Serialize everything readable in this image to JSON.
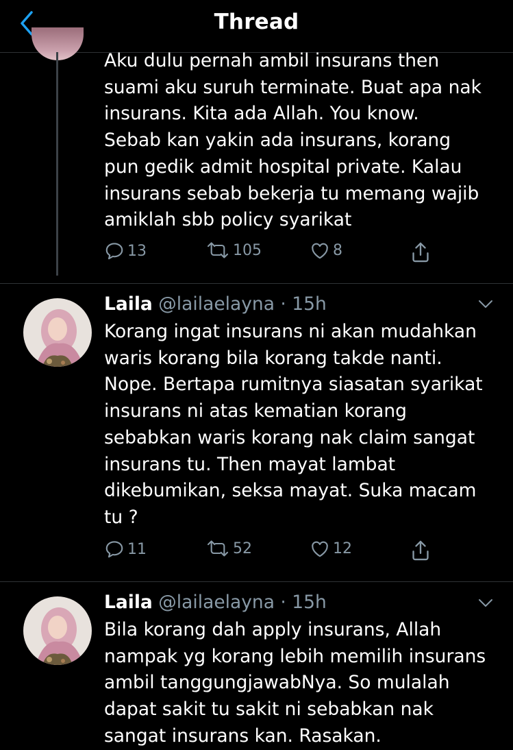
{
  "header": {
    "title": "Thread"
  },
  "tweets": [
    {
      "text": "Aku dulu pernah ambil insurans then\nsuami aku suruh terminate. Buat apa nak\ninsurans. Kita ada Allah. You know.\nSebab kan yakin ada insurans, korang\npun gedik admit hospital private. Kalau\ninsurans sebab bekerja tu memang wajib\namiklah sbb policy syarikat",
      "replies": "13",
      "retweets": "105",
      "likes": "8"
    },
    {
      "name": "Laila",
      "handle": "@lailaelayna",
      "time": "· 15h",
      "text": "Korang ingat insurans ni akan mudahkan\nwaris korang bila korang takde nanti.\nNope. Bertapa rumitnya siasatan syarikat\ninsurans ni atas kematian korang\nsebabkan waris korang nak claim sangat\ninsurans tu. Then mayat lambat\ndikebumikan, seksa mayat. Suka macam\ntu ?",
      "replies": "11",
      "retweets": "52",
      "likes": "12"
    },
    {
      "name": "Laila",
      "handle": "@lailaelayna",
      "time": "· 15h",
      "text": "Bila korang dah apply insurans, Allah\nnampak yg korang lebih memilih insurans\nambil tanggungjawabNya. So mulalah\ndapat sakit tu sakit ni sebabkan nak\nsangat insurans kan. Rasakan."
    }
  ],
  "colors": {
    "background": "#000000",
    "accent": "#1da1f2",
    "muted": "#8899a6",
    "divider": "#2f3336"
  },
  "icons": [
    "back-chevron-icon",
    "reply-icon",
    "retweet-icon",
    "like-icon",
    "share-icon",
    "caret-down-icon"
  ]
}
